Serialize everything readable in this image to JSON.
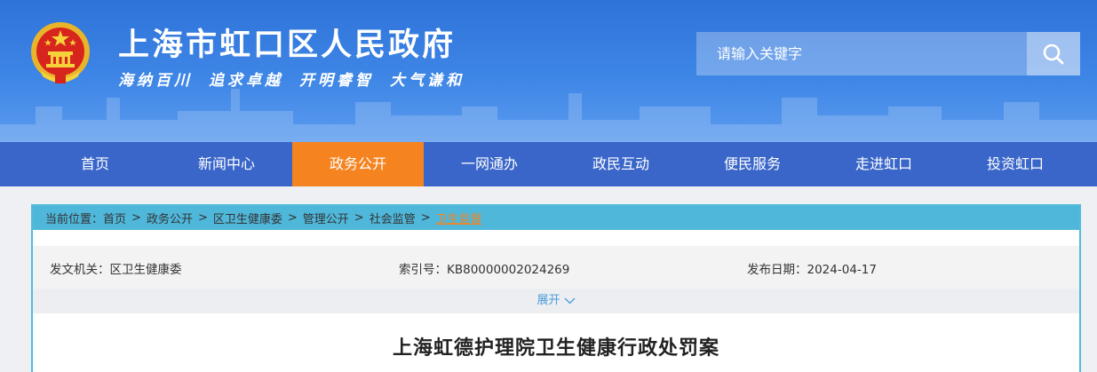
{
  "header": {
    "site_title": "上海市虹口区人民政府",
    "slogan": [
      "海纳百川",
      "追求卓越",
      "开明睿智",
      "大气谦和"
    ]
  },
  "search": {
    "placeholder": "请输入关键字"
  },
  "nav": {
    "items": [
      {
        "label": "首页",
        "active": false
      },
      {
        "label": "新闻中心",
        "active": false
      },
      {
        "label": "政务公开",
        "active": true
      },
      {
        "label": "一网通办",
        "active": false
      },
      {
        "label": "政民互动",
        "active": false
      },
      {
        "label": "便民服务",
        "active": false
      },
      {
        "label": "走进虹口",
        "active": false
      },
      {
        "label": "投资虹口",
        "active": false
      }
    ]
  },
  "breadcrumb": {
    "prefix": "当前位置：",
    "items": [
      "首页",
      "政务公开",
      "区卫生健康委",
      "管理公开",
      "社会监管",
      "卫生监督"
    ]
  },
  "meta": {
    "issuer": "发文机关：区卫生健康委",
    "index_no": "索引号：KB80000002024269",
    "publish_date": "发布日期：2024-04-17"
  },
  "expand_label": "展开",
  "document": {
    "title": "上海虹德护理院卫生健康行政处罚案"
  },
  "colors": {
    "header_blue": "#2f73d9",
    "nav_blue": "#3a66c9",
    "active_orange": "#f5831f",
    "breadcrumb_bar": "#4fb7da"
  }
}
